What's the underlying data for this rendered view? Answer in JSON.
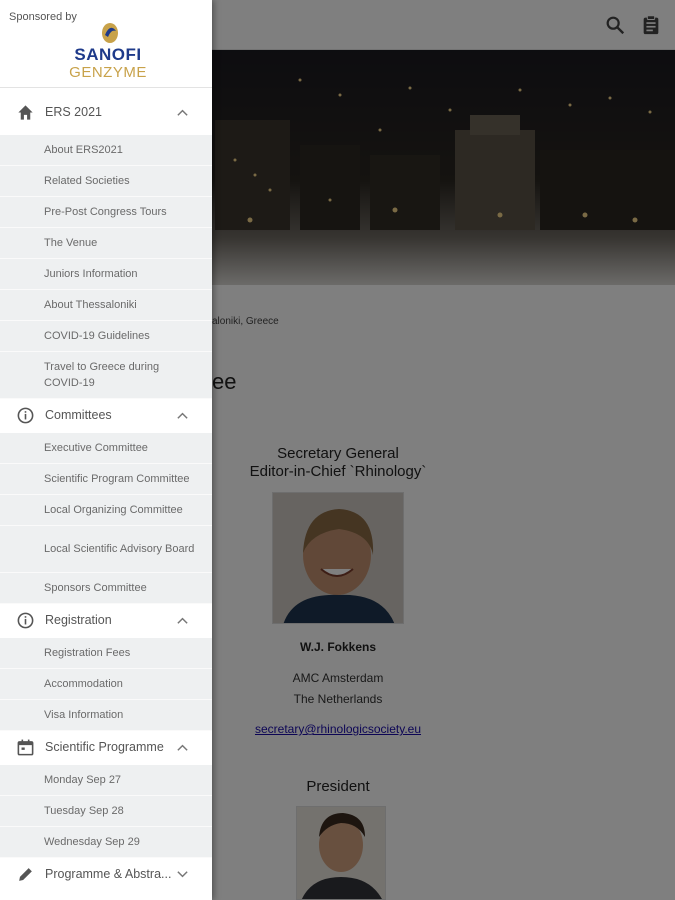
{
  "header": {
    "search_icon": "search-icon",
    "clipboard_icon": "clipboard-icon"
  },
  "content": {
    "venue_text": "aloniki, Greece",
    "page_title_fragment": "ee",
    "persons": [
      {
        "role_line1": "Secretary General",
        "role_line2": "Editor-in-Chief `Rhinology`",
        "name": "W.J. Fokkens",
        "affiliation1": "AMC Amsterdam",
        "affiliation2": "The Netherlands",
        "email": "secretary@rhinologicsociety.eu"
      },
      {
        "role_line1": "President"
      }
    ]
  },
  "drawer": {
    "sponsor_label": "Sponsored by",
    "logo_top": "SANOFI",
    "logo_bottom": "GENZYME",
    "sections": [
      {
        "title": "ERS 2021",
        "icon": "home-icon",
        "expanded": true,
        "items": [
          "About ERS2021",
          "Related Societies",
          "Pre-Post Congress Tours",
          "The Venue",
          "Juniors Information",
          "About Thessaloniki",
          "COVID-19 Guidelines",
          "Travel to Greece during COVID-19"
        ]
      },
      {
        "title": "Committees",
        "icon": "info-icon",
        "expanded": true,
        "items": [
          "Executive Committee",
          "Scientific Program Committee",
          "Local Organizing Committee",
          "Local Scientific Advisory Board",
          "Sponsors Committee"
        ]
      },
      {
        "title": "Registration",
        "icon": "info-icon",
        "expanded": true,
        "items": [
          "Registration Fees",
          "Accommodation",
          "Visa Information"
        ]
      },
      {
        "title": "Scientific Programme",
        "icon": "calendar-icon",
        "expanded": true,
        "items": [
          "Monday Sep 27",
          "Tuesday Sep 28",
          "Wednesday Sep 29"
        ]
      },
      {
        "title": "Programme & Abstra...",
        "icon": "pencil-icon",
        "expanded": false,
        "items": []
      }
    ]
  }
}
